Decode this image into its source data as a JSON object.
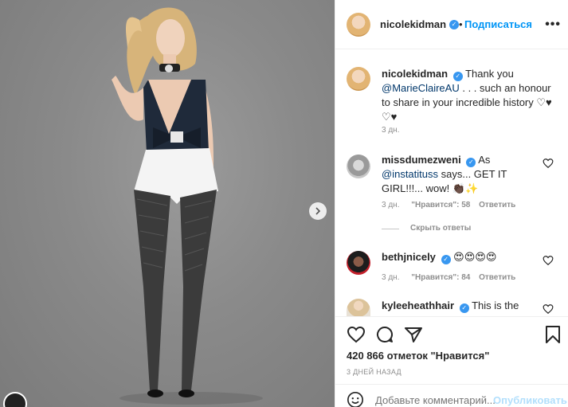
{
  "post": {
    "author": "nicolekidman",
    "follow_label": "Подписаться",
    "more_label": "•••"
  },
  "caption": {
    "author": "nicolekidman",
    "mention": "@MarieClaireAU",
    "text_before": "Thank you",
    "text_after": ". . . such an honour to share in your incredible history",
    "hearts": "♡♥ ♡♥",
    "time": "3 дн."
  },
  "comments": [
    {
      "author": "missdumezweni",
      "text": "@instatituss says... GET IT GIRL!!!... wow! 👏🏿✨",
      "mention": "@instatituss",
      "rest": "says... GET IT GIRL!!!... wow! 👏🏿✨",
      "before": "As",
      "time": "3 дн.",
      "likes": "\"Нравится\": 58",
      "reply": "Ответить",
      "hide_replies": "Скрыть ответы"
    },
    {
      "author": "bethjnicely",
      "text": "😍😍😍😍",
      "time": "3 дн.",
      "likes": "\"Нравится\": 84",
      "reply": "Ответить"
    },
    {
      "author": "kyleeheathhair",
      "text": "This is the"
    }
  ],
  "stats": {
    "likes": "420 866 отметок \"Нравится\"",
    "posted": "3 ДНЕЙ НАЗАД"
  },
  "comment_box": {
    "placeholder": "Добавьте комментарий...",
    "publish": "Опубликовать"
  }
}
